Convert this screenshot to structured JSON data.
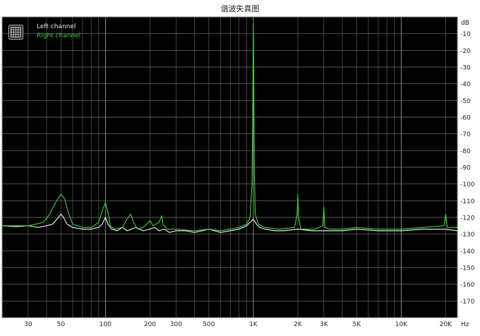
{
  "chart_data": {
    "type": "line",
    "title": "谐波失真图",
    "xlabel": "Hz",
    "ylabel": "dB",
    "xscale": "log",
    "xlim": [
      20,
      24000
    ],
    "ylim": [
      -180,
      0
    ],
    "grid": true,
    "legend": "top-left",
    "x_tick_values": [
      30,
      50,
      100,
      200,
      300,
      500,
      1000,
      2000,
      3000,
      5000,
      10000,
      20000
    ],
    "x_tick_labels": [
      "30",
      "50",
      "100",
      "200",
      "300",
      "500",
      "1K",
      "2K",
      "3K",
      "5K",
      "10K",
      "20K"
    ],
    "y_ticks": [
      -10,
      -20,
      -30,
      -40,
      -50,
      -60,
      -70,
      -80,
      -90,
      -100,
      -110,
      -120,
      -130,
      -140,
      -150,
      -160,
      -170
    ],
    "series": [
      {
        "name": "Left channel",
        "color": "#e8e8e8",
        "points": [
          [
            20,
            -125
          ],
          [
            25,
            -125.5
          ],
          [
            30,
            -125
          ],
          [
            35,
            -126
          ],
          [
            40,
            -125
          ],
          [
            44,
            -124
          ],
          [
            48,
            -120
          ],
          [
            50,
            -118
          ],
          [
            52,
            -120
          ],
          [
            55,
            -124
          ],
          [
            60,
            -126
          ],
          [
            70,
            -127
          ],
          [
            80,
            -127
          ],
          [
            90,
            -126
          ],
          [
            95,
            -124
          ],
          [
            100,
            -120
          ],
          [
            104,
            -124
          ],
          [
            110,
            -127
          ],
          [
            120,
            -128
          ],
          [
            130,
            -126
          ],
          [
            140,
            -128
          ],
          [
            150,
            -127
          ],
          [
            160,
            -126
          ],
          [
            170,
            -127
          ],
          [
            180,
            -128
          ],
          [
            200,
            -127
          ],
          [
            215,
            -126
          ],
          [
            230,
            -128
          ],
          [
            250,
            -127
          ],
          [
            270,
            -129
          ],
          [
            300,
            -128
          ],
          [
            350,
            -128
          ],
          [
            400,
            -129
          ],
          [
            450,
            -128
          ],
          [
            500,
            -127
          ],
          [
            600,
            -129
          ],
          [
            700,
            -128
          ],
          [
            800,
            -127
          ],
          [
            900,
            -125
          ],
          [
            950,
            -123
          ],
          [
            1000,
            -121
          ],
          [
            1050,
            -124
          ],
          [
            1100,
            -126
          ],
          [
            1200,
            -127
          ],
          [
            1400,
            -128
          ],
          [
            1600,
            -128
          ],
          [
            2000,
            -127
          ],
          [
            2500,
            -128
          ],
          [
            3000,
            -128
          ],
          [
            4000,
            -128
          ],
          [
            5000,
            -127
          ],
          [
            7000,
            -128
          ],
          [
            10000,
            -128
          ],
          [
            14000,
            -127
          ],
          [
            20000,
            -127
          ],
          [
            24000,
            -128
          ]
        ]
      },
      {
        "name": "Right channel",
        "color": "#3fd23f",
        "points": [
          [
            20,
            -125
          ],
          [
            30,
            -125
          ],
          [
            38,
            -123
          ],
          [
            42,
            -118
          ],
          [
            46,
            -111
          ],
          [
            50,
            -106
          ],
          [
            53,
            -109
          ],
          [
            56,
            -117
          ],
          [
            60,
            -124
          ],
          [
            70,
            -126
          ],
          [
            80,
            -126
          ],
          [
            90,
            -123
          ],
          [
            96,
            -115
          ],
          [
            100,
            -111
          ],
          [
            104,
            -117
          ],
          [
            108,
            -125
          ],
          [
            115,
            -127
          ],
          [
            130,
            -126
          ],
          [
            140,
            -121
          ],
          [
            148,
            -118
          ],
          [
            155,
            -123
          ],
          [
            165,
            -127
          ],
          [
            180,
            -126
          ],
          [
            200,
            -122
          ],
          [
            210,
            -125
          ],
          [
            230,
            -123
          ],
          [
            240,
            -119
          ],
          [
            245,
            -124
          ],
          [
            260,
            -127
          ],
          [
            300,
            -127
          ],
          [
            400,
            -128
          ],
          [
            500,
            -127
          ],
          [
            600,
            -128
          ],
          [
            700,
            -127
          ],
          [
            800,
            -126
          ],
          [
            900,
            -124
          ],
          [
            950,
            -120
          ],
          [
            980,
            -100
          ],
          [
            990,
            -60
          ],
          [
            998,
            -12
          ],
          [
            1000,
            -4
          ],
          [
            1005,
            -25
          ],
          [
            1015,
            -90
          ],
          [
            1030,
            -118
          ],
          [
            1080,
            -124
          ],
          [
            1200,
            -126
          ],
          [
            1500,
            -127
          ],
          [
            1900,
            -126
          ],
          [
            1980,
            -118
          ],
          [
            2000,
            -106
          ],
          [
            2020,
            -120
          ],
          [
            2100,
            -127
          ],
          [
            2600,
            -127
          ],
          [
            2950,
            -125
          ],
          [
            3000,
            -114
          ],
          [
            3050,
            -126
          ],
          [
            3300,
            -127
          ],
          [
            4000,
            -127
          ],
          [
            5000,
            -126
          ],
          [
            7000,
            -127
          ],
          [
            10000,
            -127
          ],
          [
            14000,
            -126
          ],
          [
            19500,
            -125
          ],
          [
            20000,
            -118
          ],
          [
            20500,
            -126
          ],
          [
            24000,
            -126
          ]
        ]
      }
    ]
  }
}
